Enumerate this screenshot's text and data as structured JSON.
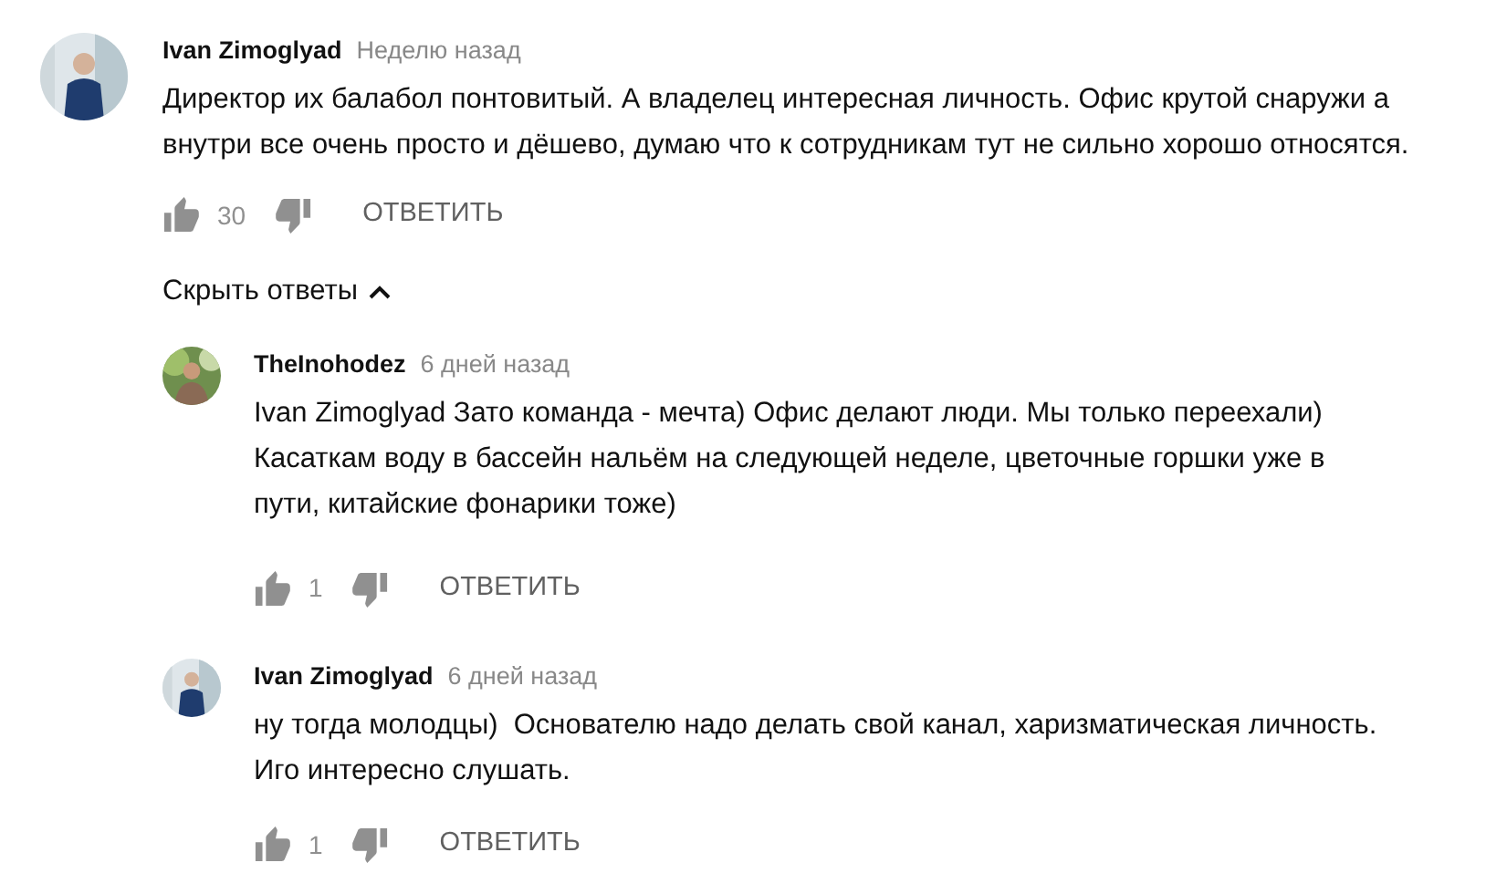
{
  "comment": {
    "author": "Ivan Zimoglyad",
    "time": "Неделю назад",
    "text": "Директор их балабол понтовитый. А владелец интересная личность. Офис крутой снаружи а внутри все очень просто и дёшево, думаю что к сотрудникам тут не сильно хорошо относятся.",
    "likes": "30",
    "reply_label": "ОТВЕТИТЬ"
  },
  "replies_toggle": {
    "label": "Скрыть ответы",
    "expanded": true
  },
  "replies": [
    {
      "author": "TheInohodez",
      "time": "6 дней назад",
      "text": "Ivan Zimoglyad Зато команда - мечта) Офис делают люди. Мы только переехали) Касаткам воду в бассейн нальём на следующей неделе, цветочные горшки уже в пути, китайские фонарики тоже)",
      "likes": "1",
      "reply_label": "ОТВЕТИТЬ"
    },
    {
      "author": "Ivan Zimoglyad",
      "time": "6 дней назад",
      "text": "ну тогда молодцы)  Основателю надо делать свой канал, харизматическая личность. Иго интересно слушать.",
      "likes": "1",
      "reply_label": "ОТВЕТИТЬ"
    }
  ]
}
